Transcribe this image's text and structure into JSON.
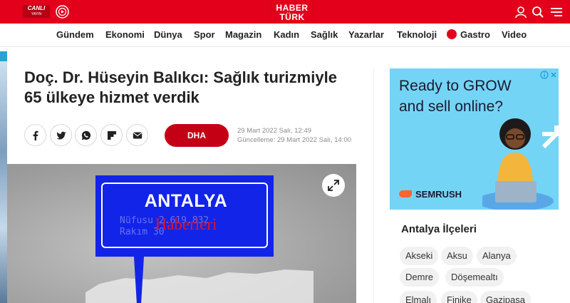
{
  "header": {
    "live_badge": {
      "line1": "CANLI",
      "line2": "YAYIN"
    },
    "logo": {
      "line1": "HABER",
      "line2": "TÜRK"
    },
    "icons": [
      "tv-icon",
      "user-icon",
      "search-icon",
      "menu-icon"
    ]
  },
  "nav": {
    "items": [
      {
        "label": "Gündem"
      },
      {
        "label": "Ekonomi"
      },
      {
        "label": "Dünya"
      },
      {
        "label": "Spor"
      },
      {
        "label": "Magazin"
      },
      {
        "label": "Kadın"
      },
      {
        "label": "Sağlık"
      },
      {
        "label": "Yazarlar"
      },
      {
        "label": "Teknoloji"
      },
      {
        "label": "Gastro"
      },
      {
        "label": "Video"
      }
    ]
  },
  "article": {
    "title": "Doç. Dr. Hüseyin Balıkcı: Sağlık turizmiyle 65 ülkeye hizmet verdik",
    "source": "DHA",
    "published": "29 Mart 2022 Salı, 12:49",
    "updated": "Güncelleme: 29 Mart 2022 Salı, 14:00",
    "share_icons": [
      "facebook-icon",
      "twitter-icon",
      "whatsapp-icon",
      "flipboard-icon",
      "mail-icon"
    ],
    "image": {
      "sign_title": "ANTALYA",
      "sign_line1": "Nüfusu  2.619.832",
      "sign_line2": "Rakım        30",
      "overlay_text": "Haberleri"
    }
  },
  "ad": {
    "headline_line1": "Ready to GROW",
    "headline_line2": "and sell online?",
    "brand": "SEMRUSH"
  },
  "sidebar": {
    "title": "Antalya İlçeleri",
    "districts": [
      "Akseki",
      "Aksu",
      "Alanya",
      "Demre",
      "Döşemealtı",
      "Elmalı",
      "Finike",
      "Gazipaşa"
    ]
  },
  "colors": {
    "brand_red": "#e3001b",
    "source_button": "#c40015",
    "ad_background": "#74d4f6",
    "sign_blue": "#1224e8"
  }
}
